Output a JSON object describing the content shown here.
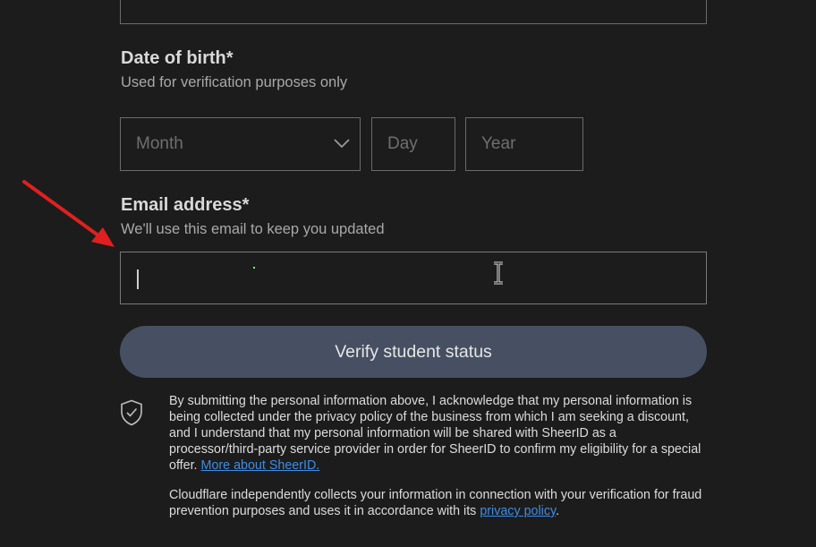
{
  "dob": {
    "label": "Date of birth*",
    "sublabel": "Used for verification purposes only",
    "month_placeholder": "Month",
    "day_placeholder": "Day",
    "year_placeholder": "Year"
  },
  "email": {
    "label": "Email address*",
    "sublabel": "We'll use this email to keep you updated",
    "value": ""
  },
  "verify_button": {
    "label": "Verify student status"
  },
  "legal": {
    "paragraph1": "By submitting the personal information above, I acknowledge that my personal information is being collected under the privacy policy of the business from which I am seeking a discount, and I understand that my personal information will be shared with SheerID as a processor/third-party service provider in order for SheerID to confirm my eligibility for a special offer.",
    "paragraph1_link": "More about SheerID.",
    "paragraph2": "Cloudflare independently collects your information in connection with your verification for fraud prevention purposes and uses it in accordance with its",
    "paragraph2_link": "privacy policy",
    "paragraph2_end": "."
  },
  "colors": {
    "background": "#1c1c1c",
    "button": "#465062",
    "link": "#3d8de8",
    "annotation_arrow": "#e02020"
  }
}
